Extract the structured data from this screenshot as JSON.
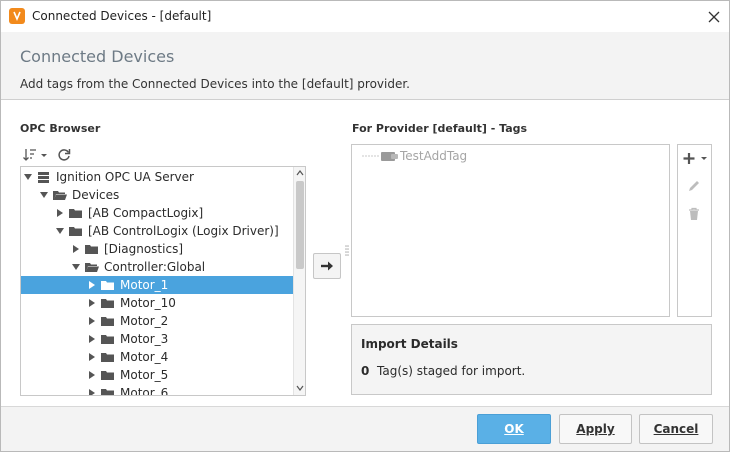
{
  "window": {
    "title": "Connected Devices - [default]"
  },
  "header": {
    "title": "Connected Devices",
    "description": "Add tags from the Connected Devices into the [default] provider."
  },
  "browser": {
    "label": "OPC Browser",
    "tree": [
      {
        "label": "Ignition OPC UA Server",
        "icon": "server-icon",
        "expander": "expanded"
      },
      {
        "label": "Devices",
        "icon": "folder-open-icon",
        "expander": "expanded"
      },
      {
        "label": "[AB CompactLogix]",
        "icon": "folder-icon",
        "expander": "collapsed"
      },
      {
        "label": "[AB ControlLogix (Logix Driver)]",
        "icon": "folder-icon",
        "expander": "expanded"
      },
      {
        "label": "[Diagnostics]",
        "icon": "folder-icon",
        "expander": "collapsed"
      },
      {
        "label": "Controller:Global",
        "icon": "folder-open-icon",
        "expander": "expanded"
      },
      {
        "label": "Motor_1",
        "icon": "folder-icon",
        "expander": "collapsed",
        "selected": true
      },
      {
        "label": "Motor_10",
        "icon": "folder-icon",
        "expander": "collapsed"
      },
      {
        "label": "Motor_2",
        "icon": "folder-icon",
        "expander": "collapsed"
      },
      {
        "label": "Motor_3",
        "icon": "folder-icon",
        "expander": "collapsed"
      },
      {
        "label": "Motor_4",
        "icon": "folder-icon",
        "expander": "collapsed"
      },
      {
        "label": "Motor_5",
        "icon": "folder-icon",
        "expander": "collapsed"
      },
      {
        "label": "Motor_6",
        "icon": "folder-icon",
        "expander": "collapsed"
      }
    ]
  },
  "tags": {
    "label": "For Provider [default] - Tags",
    "items": [
      {
        "label": "TestAddTag",
        "icon": "tag-folder-icon"
      }
    ]
  },
  "import": {
    "title": "Import Details",
    "count": "0",
    "text": "Tag(s) staged for import."
  },
  "footer": {
    "ok": "OK",
    "apply": "Apply",
    "cancel": "Cancel"
  },
  "colors": {
    "selection": "#4aa3de",
    "primary_button": "#5ab0e6",
    "app_icon": "#f28a1c"
  }
}
